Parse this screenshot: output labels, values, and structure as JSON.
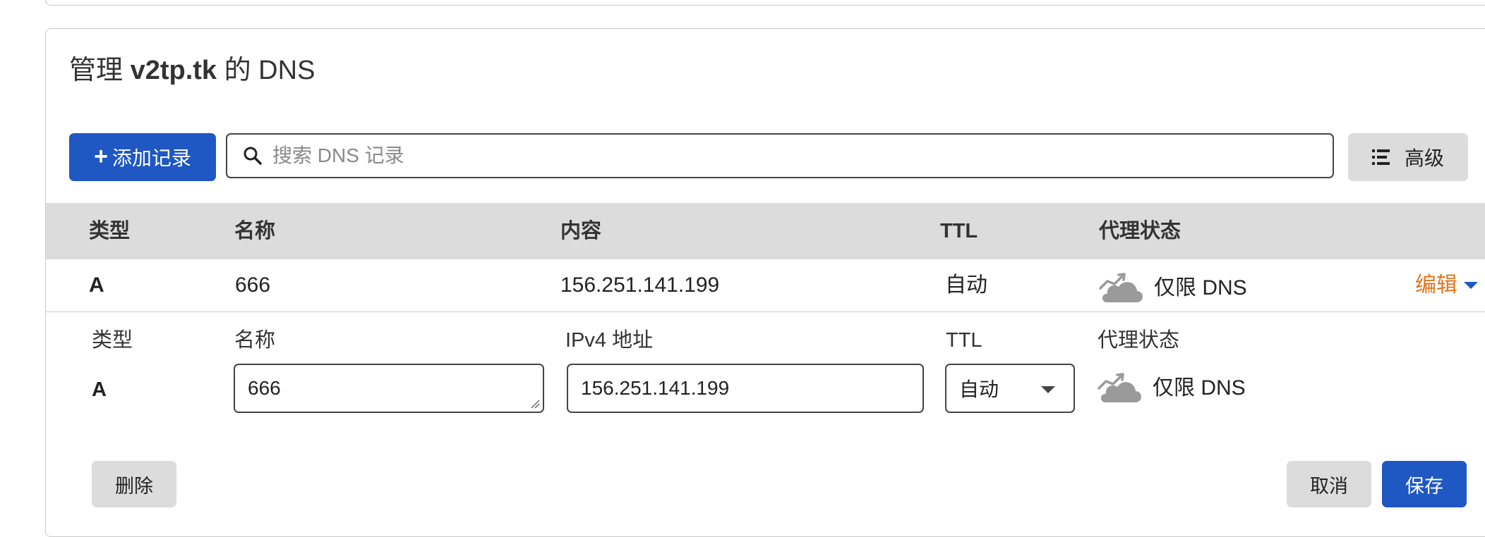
{
  "header": {
    "title_prefix": "管理",
    "domain": "v2tp.tk",
    "title_suffix": "的 DNS"
  },
  "toolbar": {
    "add_record_label": "添加记录",
    "search_placeholder": "搜索 DNS 记录",
    "advanced_label": "高级"
  },
  "table": {
    "columns": [
      "类型",
      "名称",
      "内容",
      "TTL",
      "代理状态"
    ],
    "rows": [
      {
        "type": "A",
        "name": "666",
        "content": "156.251.141.199",
        "ttl": "自动",
        "proxy_status": "仅限 DNS",
        "action": "编辑"
      }
    ]
  },
  "edit_form": {
    "type_label": "类型",
    "type_value": "A",
    "name_label": "名称",
    "name_value": "666",
    "ipv4_label": "IPv4 地址",
    "ipv4_value": "156.251.141.199",
    "ttl_label": "TTL",
    "ttl_value": "自动",
    "proxy_label": "代理状态",
    "proxy_value": "仅限 DNS",
    "delete_label": "删除",
    "cancel_label": "取消",
    "save_label": "保存"
  },
  "colors": {
    "primary": "#1f57c3",
    "edit_link": "#e0751e",
    "header_bg": "#dcdcdc",
    "cloud_icon": "#9a9a9a"
  },
  "icons": {
    "search": "search-icon",
    "advanced": "list-icon",
    "proxy": "cloud-dns-only-icon",
    "edit_caret": "caret-down-icon"
  }
}
